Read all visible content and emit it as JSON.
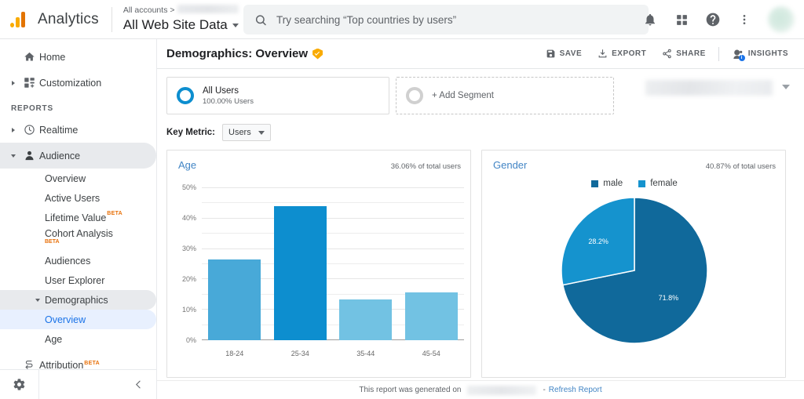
{
  "topbar": {
    "brand": "Analytics",
    "breadcrumb_label": "All accounts >",
    "property": "All Web Site Data",
    "search_placeholder": "Try searching “Top countries by users”",
    "icons": [
      "bell-icon",
      "apps-grid-icon",
      "help-icon",
      "more-vert-icon",
      "avatar"
    ]
  },
  "sidebar": {
    "items": [
      {
        "label": "Home",
        "icon": "home-icon"
      },
      {
        "label": "Customization",
        "icon": "customization-icon"
      }
    ],
    "section_label": "REPORTS",
    "reports": [
      {
        "label": "Realtime",
        "icon": "clock-icon"
      },
      {
        "label": "Audience",
        "icon": "person-icon"
      }
    ],
    "audience_children": [
      {
        "label": "Overview",
        "badge": ""
      },
      {
        "label": "Active Users",
        "badge": ""
      },
      {
        "label": "Lifetime Value",
        "badge": "BETA"
      },
      {
        "label": "Cohort Analysis",
        "badge": "BETA"
      },
      {
        "label": "Audiences",
        "badge": ""
      },
      {
        "label": "User Explorer",
        "badge": ""
      }
    ],
    "demographics": {
      "label": "Demographics"
    },
    "demographics_children": [
      {
        "label": "Overview",
        "active": true
      },
      {
        "label": "Age",
        "active": false
      }
    ],
    "attribution": {
      "label": "Attribution",
      "badge": "BETA",
      "icon": "attribution-icon"
    },
    "footer": {
      "gear": "settings-gear-icon",
      "collapse": "collapse-chevron-icon"
    }
  },
  "page": {
    "title": "Demographics: Overview",
    "verified_icon": "shield-check-icon",
    "actions": [
      {
        "label": "SAVE",
        "icon": "save-icon"
      },
      {
        "label": "EXPORT",
        "icon": "export-icon"
      },
      {
        "label": "SHARE",
        "icon": "share-icon"
      },
      {
        "label": "INSIGHTS",
        "icon": "insights-icon"
      }
    ]
  },
  "segments": {
    "all_users": {
      "name": "All Users",
      "sub": "100.00% Users"
    },
    "add_segment": "+ Add Segment"
  },
  "key_metric": {
    "label": "Key Metric:",
    "value": "Users"
  },
  "footer": {
    "text": "This report was generated on",
    "separator": "-",
    "refresh": "Refresh Report"
  },
  "colors": {
    "accent_blue": "#4285c5",
    "link_blue": "#1a73e8",
    "bar_dark": "#0D8ECF",
    "bar_mid": "#48A9D8",
    "bar_light": "#72C2E3",
    "pie_male": "#10699B",
    "pie_female": "#1593CE",
    "beta_orange": "#E8710A",
    "logo_orange": "#F9AB00"
  },
  "chart_data": [
    {
      "type": "bar",
      "title": "Age",
      "note": "36.06% of total users",
      "categories": [
        "18-24",
        "25-34",
        "35-44",
        "45-54"
      ],
      "values": [
        26.5,
        44.2,
        13.3,
        15.8
      ],
      "colors": [
        "#48A9D8",
        "#0D8ECF",
        "#72C2E3",
        "#72C2E3"
      ],
      "xlabel": "",
      "ylabel": "",
      "ylim": [
        0,
        50
      ],
      "yticks": [
        0,
        10,
        20,
        30,
        40,
        50
      ],
      "ytick_labels": [
        "0%",
        "10%",
        "20%",
        "30%",
        "40%",
        "50%"
      ],
      "grid": true,
      "legend": "none"
    },
    {
      "type": "pie",
      "title": "Gender",
      "note": "40.87% of total users",
      "categories": [
        "male",
        "female"
      ],
      "values": [
        71.8,
        28.2
      ],
      "data_labels": [
        "71.8%",
        "28.2%"
      ],
      "colors": [
        "#10699B",
        "#1593CE"
      ],
      "legend": "top"
    }
  ]
}
